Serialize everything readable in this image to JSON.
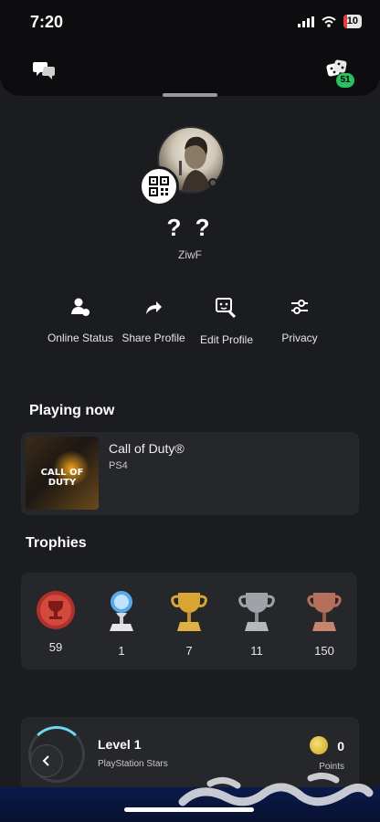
{
  "status_bar": {
    "time": "7:20",
    "battery": "10"
  },
  "header": {
    "notifications_badge": "51"
  },
  "profile": {
    "name": "? ?",
    "online_id": "ZiwF"
  },
  "actions": [
    {
      "label": "Online Status",
      "icon": "online-status-icon"
    },
    {
      "label": "Share Profile",
      "icon": "share-icon"
    },
    {
      "label": "Edit Profile",
      "icon": "edit-profile-icon"
    },
    {
      "label": "Privacy",
      "icon": "sliders-icon"
    }
  ],
  "playing_now": {
    "title": "Playing now",
    "game": {
      "title": "Call of Duty®",
      "platform": "PS4",
      "art_text": "CALL OF DUTY"
    }
  },
  "trophies": {
    "title": "Trophies",
    "items": [
      {
        "type": "level",
        "count": "59"
      },
      {
        "type": "platinum",
        "count": "1"
      },
      {
        "type": "gold",
        "count": "7"
      },
      {
        "type": "silver",
        "count": "11"
      },
      {
        "type": "bronze",
        "count": "150"
      }
    ]
  },
  "stars": {
    "level": "Level 1",
    "subtitle": "PlayStation Stars",
    "points": "0",
    "points_label": "Points"
  },
  "colors": {
    "background": "#1b1c1f",
    "card": "#26272b",
    "badge": "#2ac060"
  }
}
